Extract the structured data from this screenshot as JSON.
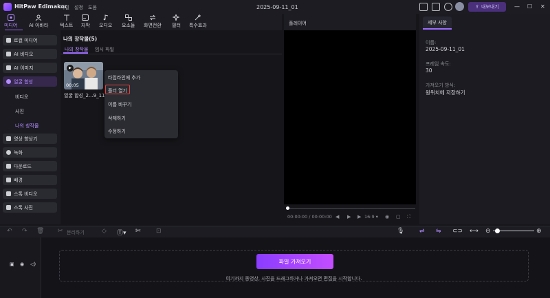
{
  "app": {
    "name": "HitPaw Edimakor",
    "menus": [
      "파일",
      "설정",
      "도움"
    ],
    "title": "2025-09-11_01",
    "export_label": "내보내기"
  },
  "toolbar": [
    {
      "label": "미디어",
      "icon": "media-icon"
    },
    {
      "label": "AI 아바타",
      "icon": "avatar-icon"
    },
    {
      "label": "텍스트",
      "icon": "text-icon"
    },
    {
      "label": "자막",
      "icon": "subtitle-icon"
    },
    {
      "label": "오디오",
      "icon": "music-icon"
    },
    {
      "label": "요소들",
      "icon": "elements-icon"
    },
    {
      "label": "화면전환",
      "icon": "transition-icon"
    },
    {
      "label": "필터",
      "icon": "filter-icon"
    },
    {
      "label": "특수효과",
      "icon": "effects-icon"
    }
  ],
  "sidebar": {
    "items": [
      "로컬 미디어",
      "AI 비디오",
      "AI 이미지",
      "얼굴 합성"
    ],
    "subitems": [
      "비디오",
      "사진",
      "나의 창작물"
    ],
    "items2": [
      "영상 향상기",
      "녹화",
      "다운로드",
      "배경",
      "스톡 비디오",
      "스톡 사진"
    ]
  },
  "media": {
    "title": "나의 창작물(5)",
    "tabs": [
      "나의 창작물",
      "임시 파일"
    ],
    "thumb_duration": "00:05",
    "thumb_name": "얼굴 합성_2...9_110..."
  },
  "context_menu": [
    "타임라인에 추가",
    "폴더 열기",
    "이름 바꾸기",
    "삭제하기",
    "수정하기"
  ],
  "player": {
    "title": "플레이어",
    "time_current": "00:00:00",
    "time_total": "00:00:00",
    "aspect": "16:9"
  },
  "details": {
    "tab": "세부 사항",
    "name_label": "이름:",
    "name_value": "2025-09-11_01",
    "fps_label": "프레임 속도:",
    "fps_value": "30",
    "import_label": "가져오기 방식:",
    "import_value": "원위치에 저장하기"
  },
  "timeline": {
    "split_label": "분리하기",
    "import_button": "파일 가져오기",
    "hint": "여기까지 동영상, 사진을 드래그하거나 가져오면 편집을 시작합니다."
  }
}
